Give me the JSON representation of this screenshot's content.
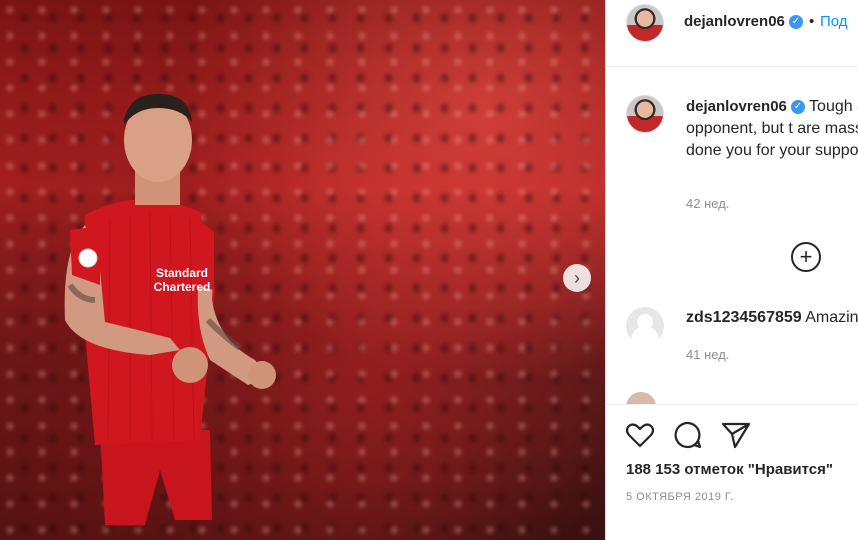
{
  "post": {
    "image_alt": "Liverpool player in red kit",
    "kit_sponsor_line1": "Standard",
    "kit_sponsor_line2": "Chartered",
    "next_icon": "chevron-right-icon"
  },
  "header": {
    "username": "dejanlovren06",
    "dot": "•",
    "follow_label": "Под"
  },
  "caption": {
    "username": "dejanlovren06",
    "text": "Tough a good opponent, but t are massive. Well done you for your support",
    "emoji": "🙂",
    "time": "42 нед."
  },
  "comments": [
    {
      "username": "zds1234567859",
      "text": "Amazin",
      "time": "41 нед."
    }
  ],
  "actions": {
    "likes": "188 153 отметок \"Нравится\"",
    "date": "5 ОКТЯБРЯ 2019 Г."
  }
}
